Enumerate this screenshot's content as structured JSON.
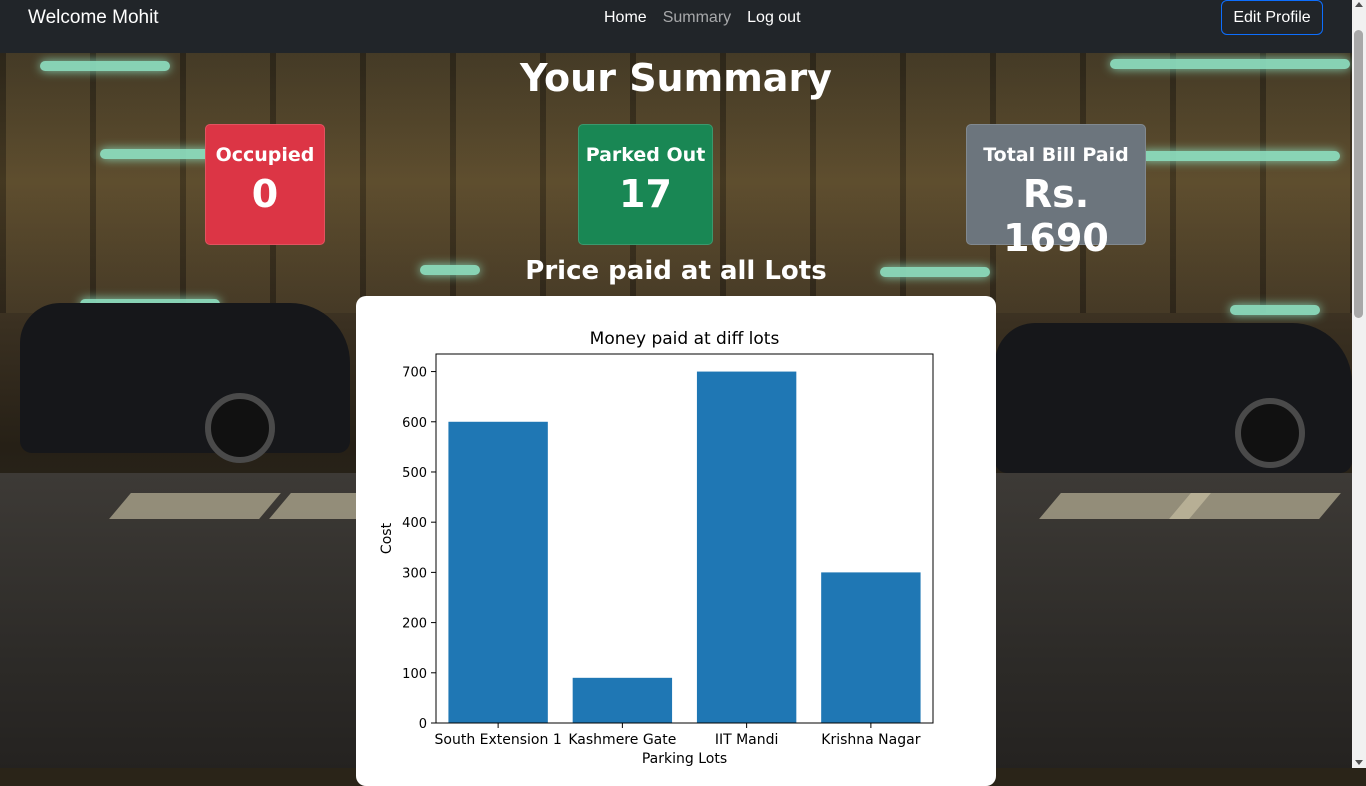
{
  "navbar": {
    "brand": "Welcome Mohit",
    "links": [
      "Home",
      "Summary",
      "Log out"
    ],
    "edit_profile": "Edit Profile"
  },
  "page": {
    "title": "Your Summary",
    "subtitle": "Price paid at all Lots"
  },
  "cards": [
    {
      "label": "Occupied",
      "value": "0",
      "color": "#dc3545"
    },
    {
      "label": "Parked Out",
      "value": "17",
      "color": "#198754"
    },
    {
      "label": "Total Bill Paid",
      "value": "Rs. 1690",
      "color": "#6c757d"
    }
  ],
  "chart_data": {
    "type": "bar",
    "title": "Money paid at diff lots",
    "xlabel": "Parking Lots",
    "ylabel": "Cost",
    "categories": [
      "South Extension 1",
      "Kashmere Gate",
      "IIT Mandi",
      "Krishna Nagar"
    ],
    "values": [
      600,
      90,
      700,
      300
    ],
    "ylim": [
      0,
      735
    ],
    "yticks": [
      0,
      100,
      200,
      300,
      400,
      500,
      600,
      700
    ],
    "bar_color": "#1f77b4",
    "grid": false
  }
}
